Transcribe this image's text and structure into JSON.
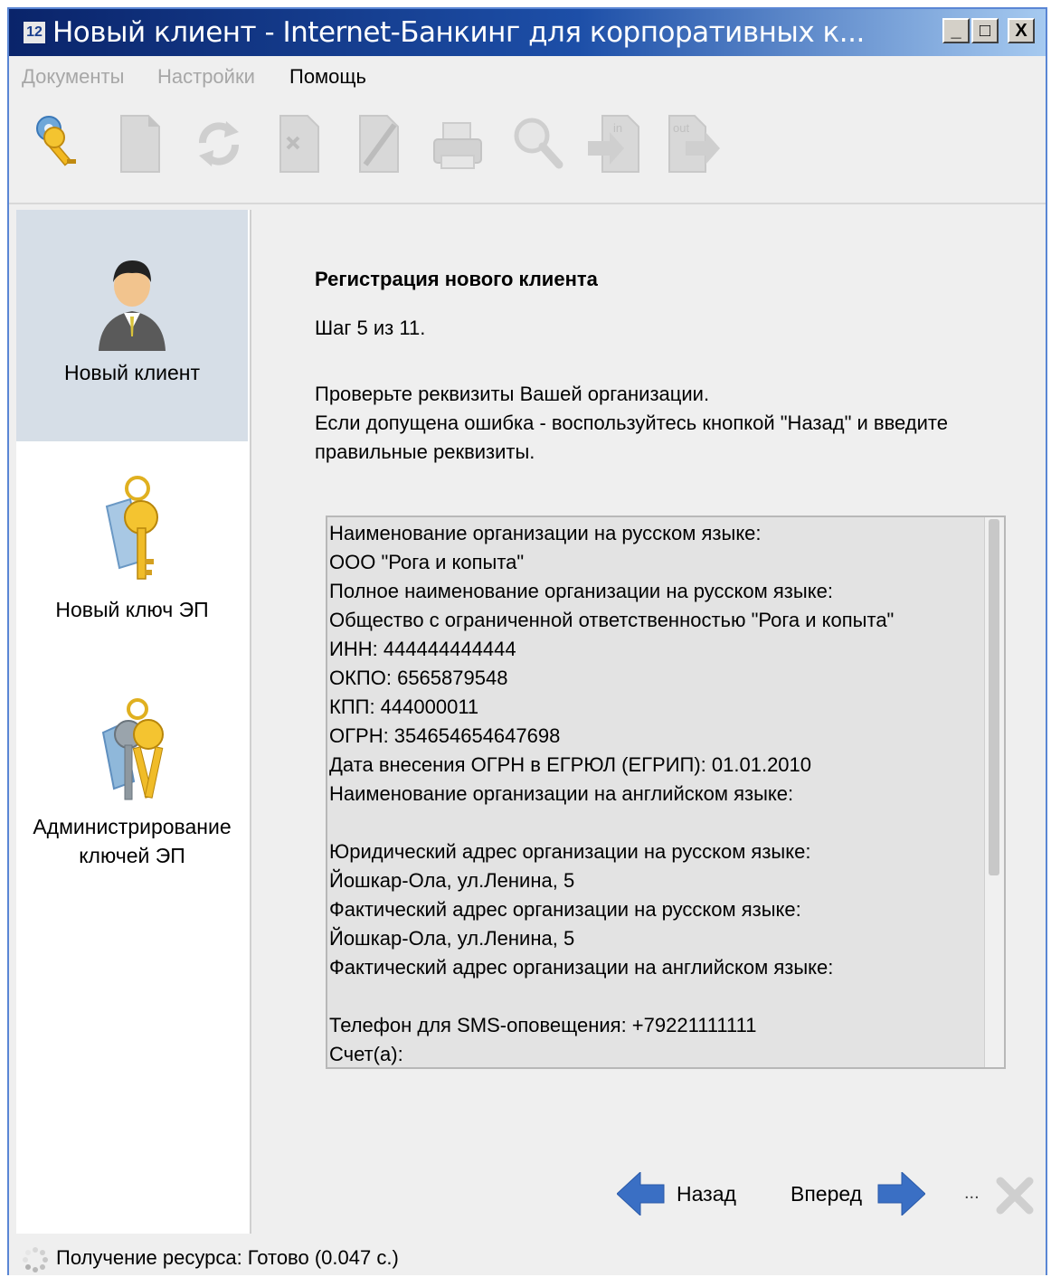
{
  "window": {
    "title": "Новый клиент - Internet-Банкинг для корпоративных к...",
    "app_icon": "app-logo-icon",
    "controls": {
      "minimize": "_",
      "maximize": "□",
      "close": "X"
    }
  },
  "menu": {
    "documents": "Документы",
    "settings": "Настройки",
    "help": "Помощь"
  },
  "toolbar": {
    "buttons": [
      "keys-icon",
      "new-document-icon",
      "refresh-icon",
      "delete-document-icon",
      "edit-document-icon",
      "print-icon",
      "search-icon",
      "import-in-icon",
      "export-out-icon"
    ],
    "in_label": "in",
    "out_label": "out"
  },
  "sidebar": {
    "items": [
      {
        "label": "Новый клиент",
        "icon": "client-avatar-icon",
        "selected": true
      },
      {
        "label": "Новый ключ ЭП",
        "icon": "new-key-icon",
        "selected": false
      },
      {
        "label_line1": "Администрирование",
        "label_line2": "ключей ЭП",
        "icon": "keys-admin-icon",
        "selected": false
      }
    ]
  },
  "main": {
    "heading": "Регистрация нового клиента",
    "step": "Шаг 5 из 11.",
    "instruction_line1": "Проверьте реквизиты Вашей организации.",
    "instruction_line2": "Если допущена ошибка - воспользуйтесь кнопкой \"Назад\" и введите",
    "instruction_line3": "правильные реквизиты.",
    "details": [
      "Наименование организации на русском языке:",
      "ООО \"Рога и копыта\"",
      "Полное наименование организации на русском языке:",
      "Общество с ограниченной ответственностью \"Рога и копыта\"",
      "ИНН: 444444444444",
      "ОКПО: 6565879548",
      "КПП: 444000011",
      "ОГРН: 354654654647698",
      "Дата внесения ОГРН в ЕГРЮЛ (ЕГРИП): 01.01.2010",
      "Наименование организации на английском языке:",
      "",
      "Юридический адрес организации на русском языке:",
      "Йошкар-Ола, ул.Ленина, 5",
      "Фактический адрес организации на русском языке:",
      "Йошкар-Ола, ул.Ленина, 5",
      "Фактический адрес организации на английском языке:",
      "",
      "Телефон для SMS-оповещения: +79221111111",
      "Счет(а):"
    ],
    "back_label": "Назад",
    "forward_label": "Вперед",
    "ellipsis": "...",
    "colors": {
      "arrow": "#3a6fc4",
      "selected_item": "#d6dee7"
    }
  },
  "status": {
    "text": "Получение ресурса: Готово (0.047 с.)"
  }
}
